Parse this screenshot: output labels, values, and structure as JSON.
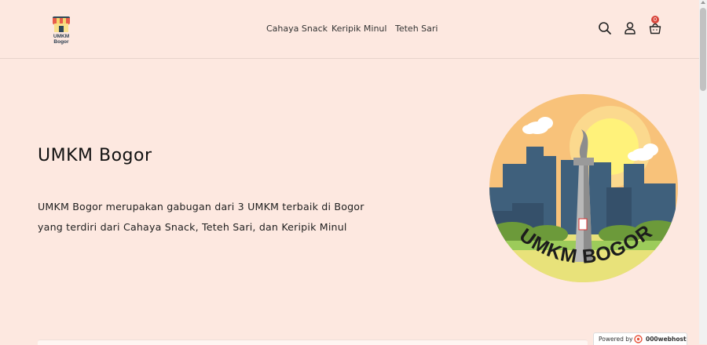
{
  "brand": {
    "logo_text": "UMKM Bogor"
  },
  "nav": {
    "items": [
      {
        "label": "Cahaya Snack"
      },
      {
        "label": "Keripik Minul"
      },
      {
        "label": "Teteh Sari"
      }
    ]
  },
  "header_icons": {
    "search_icon": "search-icon",
    "account_icon": "user-icon",
    "cart_icon": "shopping-bag-icon",
    "cart_count": "0"
  },
  "hero": {
    "title": "UMKM Bogor",
    "description": "UMKM Bogor merupakan gabugan dari 3 UMKM terbaik di Bogor yang terdiri dari Cahaya Snack, Teteh Sari, dan Keripik Minul",
    "illustration_text": "UMKM BOGOR"
  },
  "footer_badge": {
    "powered_label": "Powered by",
    "host_brand": "000webhost"
  },
  "colors": {
    "page_background": "#fde8e0",
    "badge_red": "#d9453b",
    "illustration_sky": "#f8c27a",
    "illustration_city": "#3f607c"
  }
}
